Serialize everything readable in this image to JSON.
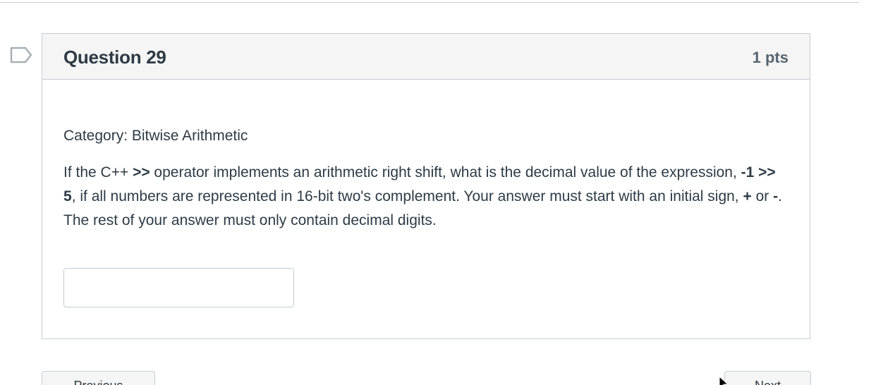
{
  "question": {
    "title": "Question 29",
    "points": "1 pts",
    "category": "Category: Bitwise Arithmetic",
    "prompt_parts": {
      "p1": "If the C++ ",
      "op1": ">>",
      "p2": " operator implements an arithmetic right shift, what is the decimal value of the expression, ",
      "expr": "-1 >> 5",
      "p3": ", if all numbers are represented in 16-bit two's complement.  Your answer must start with an initial sign, ",
      "plus": "+",
      "p4": " or ",
      "minus": "-",
      "p5": ". The rest of your answer must only contain decimal digits."
    },
    "answer_value": ""
  },
  "navigation": {
    "previous_label": "Previous",
    "next_label": "Next"
  },
  "colors": {
    "header_bg": "#f5f5f5",
    "border": "#c7cdd1",
    "text": "#2d3b45",
    "points_text": "#556572"
  },
  "icons": {
    "flag": "flag-question-icon",
    "cursor": "mouse-pointer-icon"
  }
}
